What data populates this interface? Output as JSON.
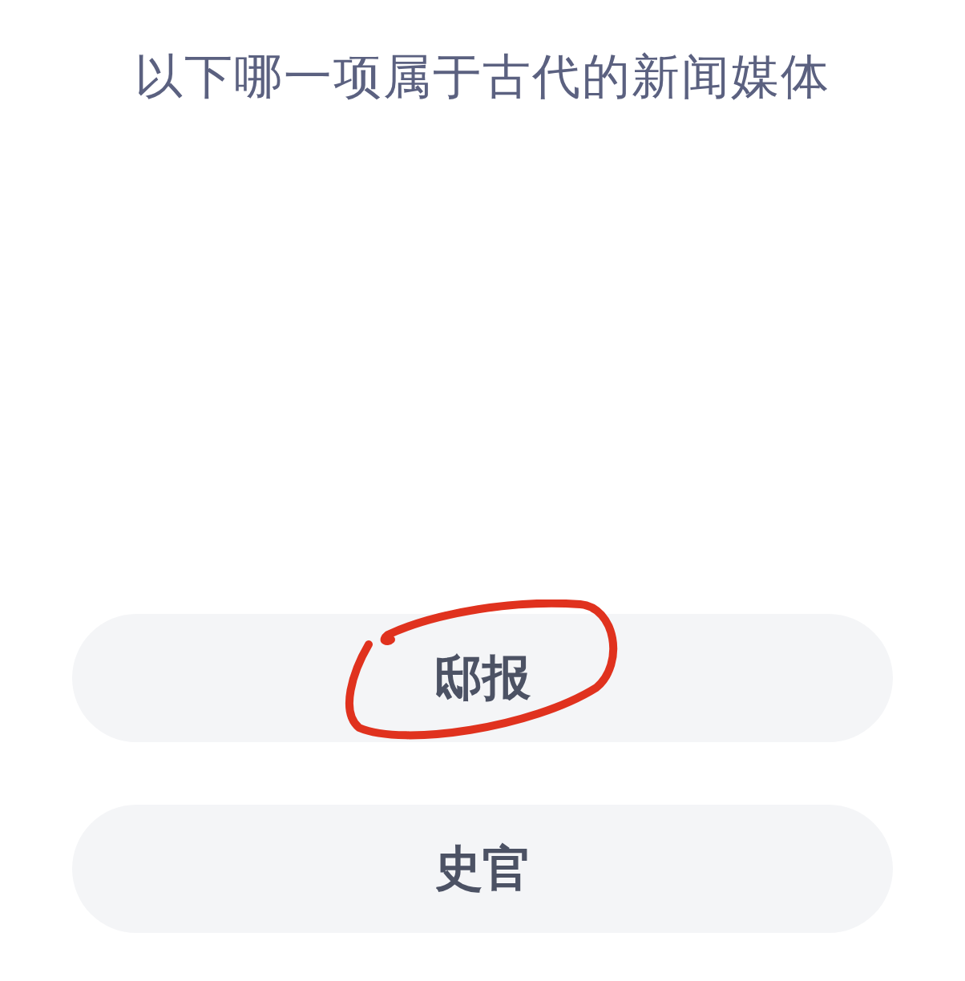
{
  "question": "以下哪一项属于古代的新闻媒体",
  "options": [
    {
      "label": "邸报",
      "circled": true
    },
    {
      "label": "史官",
      "circled": false
    }
  ]
}
